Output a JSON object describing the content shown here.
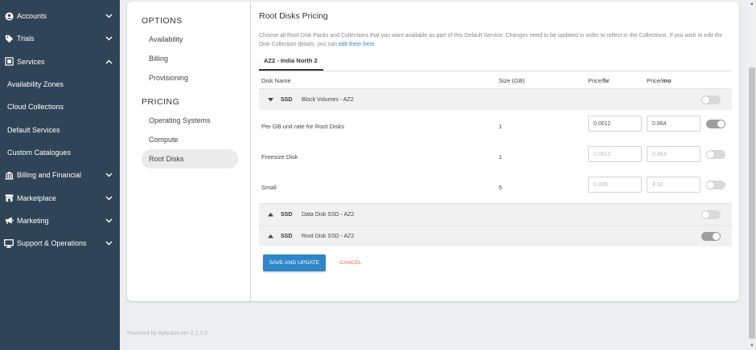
{
  "sidebar": {
    "items": [
      {
        "label": "Accounts",
        "icon": "user-icon",
        "chevron": "down"
      },
      {
        "label": "Trials",
        "icon": "tag-icon",
        "chevron": "down"
      },
      {
        "label": "Services",
        "icon": "services-icon",
        "chevron": "up"
      },
      {
        "label": "Availability Zones"
      },
      {
        "label": "Cloud Collections"
      },
      {
        "label": "Default Services"
      },
      {
        "label": "Custom Catalogues"
      },
      {
        "label": "Billing and Financial",
        "icon": "bank-icon",
        "chevron": "down"
      },
      {
        "label": "Marketplace",
        "icon": "store-icon",
        "chevron": "down"
      },
      {
        "label": "Marketing",
        "icon": "megaphone-icon",
        "chevron": "down"
      },
      {
        "label": "Support & Operations",
        "icon": "monitor-icon",
        "chevron": "down"
      }
    ]
  },
  "leftnav": {
    "options_heading": "OPTIONS",
    "options": [
      "Availability",
      "Billing",
      "Provisioning"
    ],
    "pricing_heading": "PRICING",
    "pricing": [
      "Operating Systems",
      "Compute",
      "Root Disks"
    ]
  },
  "content": {
    "title": "Root Disks Pricing",
    "description": "Choose all Root Disk Packs and Collections that you want available as part of this Default Service. Changes need to be updated in order to reflect in the Collections. If you wish to edit the Disk Collection details, you can",
    "description_link": "edit them here",
    "description_end": ".",
    "tab": "AZ2 - India North 2",
    "columns": {
      "disk_name": "Disk Name",
      "size": "Size (GB)",
      "price_hr_prefix": "Price/",
      "price_hr_unit": "hr",
      "price_mo_prefix": "Price/",
      "price_mo_unit": "mo"
    },
    "groups": [
      {
        "type": "SSD",
        "name": "Block Volumes - AZ2",
        "expanded": true,
        "enabled": false
      },
      {
        "type": "SSD",
        "name": "Data Disk SSD - AZ2",
        "expanded": false,
        "enabled": false
      },
      {
        "type": "SSD",
        "name": "Root Disk SSD - AZ2",
        "expanded": false,
        "enabled": true
      }
    ],
    "rows": [
      {
        "name": "Per GB unit rate for Root Disks",
        "size": "1",
        "price_hr": "0.0012",
        "price_mo": "0.864",
        "enabled": true
      },
      {
        "name": "Freesize Disk",
        "size": "1",
        "price_hr": "0.0012",
        "price_mo": "0.864",
        "enabled": false
      },
      {
        "name": "Small",
        "size": "5",
        "price_hr": "0.006",
        "price_mo": "4.32",
        "enabled": false
      }
    ],
    "save_label": "SAVE AND UPDATE",
    "cancel_label": "CANCEL"
  },
  "footer": "Powered by Apiculus ver 2.1.1.0",
  "colors": {
    "sidebar_bg": "#2f4457",
    "primary": "#2f86c9",
    "cancel": "#e86a4e"
  }
}
